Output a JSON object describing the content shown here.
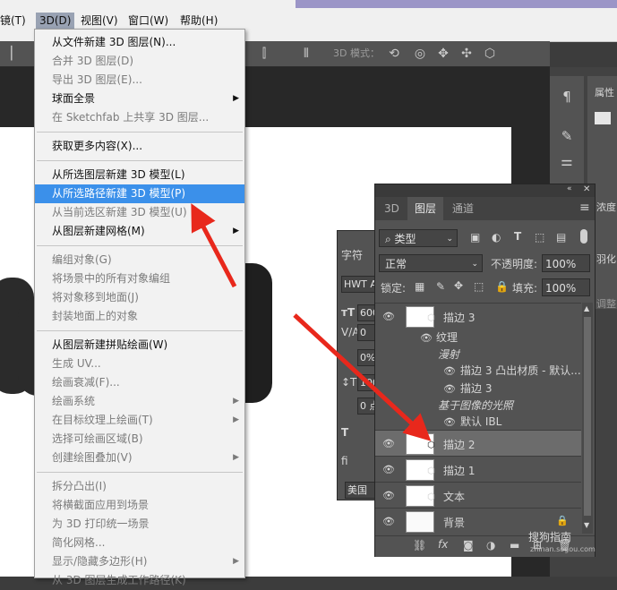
{
  "menubar": {
    "partial_left": "镜(T)",
    "items": [
      "3D(D)",
      "视图(V)",
      "窗口(W)",
      "帮助(H)"
    ],
    "active": "3D(D)"
  },
  "options_bar": {
    "mode_label": "3D 模式："
  },
  "menu_3d": {
    "items": [
      {
        "label": "从文件新建 3D 图层(N)...",
        "enabled": true
      },
      {
        "label": "合并 3D 图层(D)",
        "enabled": false
      },
      {
        "label": "导出 3D 图层(E)...",
        "enabled": false
      },
      {
        "label": "球面全景",
        "enabled": true,
        "submenu": true
      },
      {
        "label": "在 Sketchfab 上共享 3D 图层...",
        "enabled": false
      },
      {
        "label": "获取更多内容(X)...",
        "enabled": true
      },
      {
        "label": "从所选图层新建 3D 模型(L)",
        "enabled": true
      },
      {
        "label": "从所选路径新建 3D 模型(P)",
        "enabled": true,
        "highlighted": true
      },
      {
        "label": "从当前选区新建 3D 模型(U)",
        "enabled": false
      },
      {
        "label": "从图层新建网格(M)",
        "enabled": true,
        "submenu": true
      },
      {
        "label": "编组对象(G)",
        "enabled": false
      },
      {
        "label": "将场景中的所有对象编组",
        "enabled": false
      },
      {
        "label": "将对象移到地面(J)",
        "enabled": false
      },
      {
        "label": "封装地面上的对象",
        "enabled": false
      },
      {
        "label": "从图层新建拼贴绘画(W)",
        "enabled": true
      },
      {
        "label": "生成 UV...",
        "enabled": false
      },
      {
        "label": "绘画衰减(F)...",
        "enabled": false
      },
      {
        "label": "绘画系统",
        "enabled": false,
        "submenu": true
      },
      {
        "label": "在目标纹理上绘画(T)",
        "enabled": false,
        "submenu": true
      },
      {
        "label": "选择可绘画区域(B)",
        "enabled": false
      },
      {
        "label": "创建绘图叠加(V)",
        "enabled": false,
        "submenu": true
      },
      {
        "label": "拆分凸出(I)",
        "enabled": false
      },
      {
        "label": "将横截面应用到场景",
        "enabled": false
      },
      {
        "label": "为 3D 打印统一场景",
        "enabled": false
      },
      {
        "label": "简化网格...",
        "enabled": false
      },
      {
        "label": "显示/隐藏多边形(H)",
        "enabled": false,
        "submenu": true
      },
      {
        "label": "从 3D 图层生成工作路径(K)",
        "enabled": false
      }
    ]
  },
  "character_panel": {
    "title": "字符",
    "font": "HWT A",
    "size": "600",
    "kerning": "0",
    "tracking": "0%",
    "vscale": "100",
    "baseline": "0 点",
    "language": "美国"
  },
  "right_panel": {
    "properties_label": "属性",
    "density_label": "浓度",
    "feather_label": "羽化",
    "adjust_label": "调整"
  },
  "layers_panel": {
    "tabs": [
      "3D",
      "图层",
      "通道"
    ],
    "active_tab": "图层",
    "filter_kind": "类型",
    "blend_mode": "正常",
    "opacity_label": "不透明度:",
    "opacity_value": "100%",
    "lock_label": "锁定:",
    "fill_label": "填充:",
    "fill_value": "100%",
    "layers": [
      {
        "name": "描边 3",
        "type": "3d",
        "expanded": true
      },
      {
        "name": "描边 2",
        "type": "3d",
        "selected": true
      },
      {
        "name": "描边 1",
        "type": "3d"
      },
      {
        "name": "文本",
        "type": "3d"
      },
      {
        "name": "背景",
        "type": "background",
        "locked": true
      }
    ],
    "sub_items": {
      "texture": "纹理",
      "diffuse": "漫射",
      "material": "描边 3 凸出材质 - 默认...",
      "material2": "描边 3",
      "ibl_header": "基于图像的光照",
      "ibl": "默认 IBL"
    },
    "bottom_icons": [
      "link-icon",
      "fx-icon",
      "mask-icon",
      "adjustment-icon",
      "folder-icon",
      "new-layer-icon",
      "trash-icon"
    ]
  },
  "watermark": {
    "brand": "搜狗指南",
    "url": "zhinan.sogou.com"
  },
  "colors": {
    "menu_highlight": "#3b90ea",
    "arrow": "#e8281c",
    "panel": "#535353"
  }
}
